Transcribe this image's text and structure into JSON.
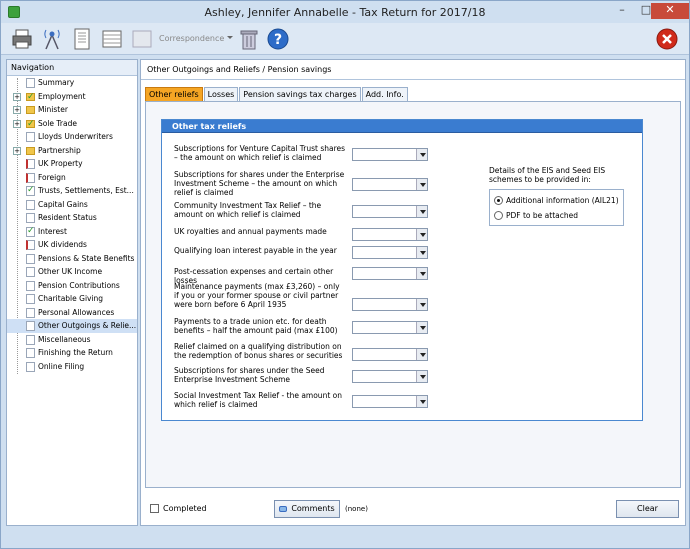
{
  "window": {
    "title": "Ashley, Jennifer Annabelle - Tax Return for 2017/18",
    "controls": [
      "–",
      "□",
      "✕"
    ]
  },
  "toolbar": {
    "correspondence_label": "Correspondence",
    "icons": [
      "printer-icon",
      "broadcast-icon",
      "document-icon",
      "list-icon",
      "blank-icon",
      "trash-icon",
      "help-icon",
      "exit-icon"
    ]
  },
  "navigation": {
    "header": "Navigation",
    "items": [
      {
        "label": "Summary",
        "expand": false,
        "icon": "doc"
      },
      {
        "label": "Employment",
        "expand": true,
        "icon": "folder-check"
      },
      {
        "label": "Minister",
        "expand": true,
        "icon": "folder"
      },
      {
        "label": "Sole Trade",
        "expand": true,
        "icon": "folder-check"
      },
      {
        "label": "Lloyds Underwriters",
        "expand": false,
        "icon": "doc"
      },
      {
        "label": "Partnership",
        "expand": true,
        "icon": "folder"
      },
      {
        "label": "UK Property",
        "expand": false,
        "icon": "doc-red"
      },
      {
        "label": "Foreign",
        "expand": false,
        "icon": "doc-red"
      },
      {
        "label": "Trusts, Settlements, Est...",
        "expand": false,
        "icon": "doc-check"
      },
      {
        "label": "Capital Gains",
        "expand": false,
        "icon": "doc"
      },
      {
        "label": "Resident Status",
        "expand": false,
        "icon": "doc"
      },
      {
        "label": "Interest",
        "expand": false,
        "icon": "doc-check"
      },
      {
        "label": "UK dividends",
        "expand": false,
        "icon": "doc-red"
      },
      {
        "label": "Pensions & State Benefits",
        "expand": false,
        "icon": "doc"
      },
      {
        "label": "Other UK Income",
        "expand": false,
        "icon": "doc"
      },
      {
        "label": "Pension Contributions",
        "expand": false,
        "icon": "doc"
      },
      {
        "label": "Charitable Giving",
        "expand": false,
        "icon": "doc"
      },
      {
        "label": "Personal Allowances",
        "expand": false,
        "icon": "doc"
      },
      {
        "label": "Other Outgoings & Relie...",
        "expand": false,
        "icon": "doc",
        "selected": true
      },
      {
        "label": "Miscellaneous",
        "expand": false,
        "icon": "doc"
      },
      {
        "label": "Finishing the Return",
        "expand": false,
        "icon": "doc"
      },
      {
        "label": "Online Filing",
        "expand": false,
        "icon": "doc"
      }
    ]
  },
  "main": {
    "breadcrumb": "Other Outgoings and Reliefs / Pension savings",
    "tabs": [
      "Other reliefs",
      "Losses",
      "Pension savings tax charges",
      "Add. Info."
    ],
    "group_title": "Other tax reliefs",
    "fields": [
      "Subscriptions for Venture Capital Trust shares – the amount on which relief is claimed",
      "Subscriptions for shares under the Enterprise Investment Scheme – the amount on which relief is claimed",
      "Community Investment Tax Relief – the amount on which relief is claimed",
      "UK royalties and annual payments made",
      "Qualifying loan interest payable in the year",
      "Post-cessation expenses and certain other losses",
      "Maintenance payments (max £3,260) – only if you or your former spouse or civil partner were born before 6 April 1935",
      "Payments to a trade union etc. for death benefits – half the amount paid (max £100)",
      "Relief claimed on a qualifying distribution on the redemption of bonus shares or securities",
      "Subscriptions for shares under the Seed Enterprise Investment Scheme",
      "Social Investment Tax Relief - the amount on which relief is claimed"
    ],
    "eis": {
      "label": "Details of the EIS and Seed EIS schemes to be provided in:",
      "options": [
        "Additional information (AIL21)",
        "PDF to be attached"
      ],
      "selected_index": 0
    }
  },
  "footer": {
    "completed_label": "Completed",
    "comments_label": "Comments",
    "comments_note": "(none)",
    "clear_label": "Clear"
  }
}
